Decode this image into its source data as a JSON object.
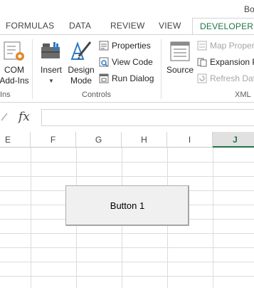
{
  "window": {
    "title": "Bo"
  },
  "tabs": [
    {
      "label": "FORMULAS",
      "active": false
    },
    {
      "label": "DATA",
      "active": false
    },
    {
      "label": "REVIEW",
      "active": false
    },
    {
      "label": "VIEW",
      "active": false
    },
    {
      "label": "DEVELOPER",
      "active": true
    }
  ],
  "ribbon": {
    "addins": {
      "com_line1": "COM",
      "com_line2": "Add-Ins",
      "group_label": "Ins"
    },
    "controls": {
      "insert_label": "Insert",
      "design_line1": "Design",
      "design_line2": "Mode",
      "properties": "Properties",
      "view_code": "View Code",
      "run_dialog": "Run Dialog",
      "group_label": "Controls"
    },
    "xml": {
      "source": "Source",
      "map_properties": "Map Proper",
      "expansion_packs": "Expansion P",
      "refresh_data": "Refresh Dat",
      "group_label": "XML"
    }
  },
  "formula_bar": {
    "fx_label": "fx",
    "value": ""
  },
  "sheet": {
    "columns": [
      {
        "label": "E",
        "selected": false
      },
      {
        "label": "F",
        "selected": false
      },
      {
        "label": "G",
        "selected": false
      },
      {
        "label": "H",
        "selected": false
      },
      {
        "label": "I",
        "selected": false
      },
      {
        "label": "J",
        "selected": true
      }
    ],
    "form_button_label": "Button 1"
  },
  "colors": {
    "accent": "#217346",
    "grid": "#dadcdd"
  }
}
